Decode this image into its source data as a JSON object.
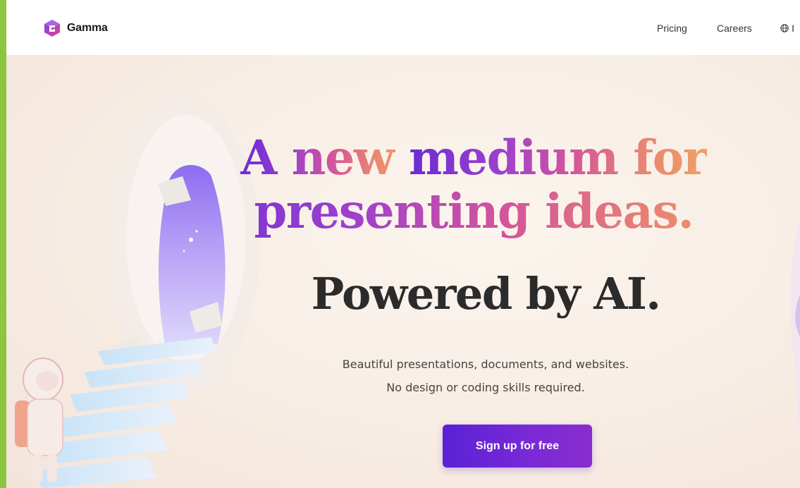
{
  "brand": {
    "name": "Gamma",
    "logo_icon": "gamma-logo-icon"
  },
  "nav": {
    "links": [
      "Pricing",
      "Careers"
    ],
    "language_icon": "globe-icon",
    "language_text": "I"
  },
  "hero": {
    "headline_line1_part1": "A new ",
    "headline_line1_part2": "medium for",
    "headline_line2": "presenting ideas.",
    "subheadline": "Powered by AI.",
    "description_line1": "Beautiful presentations, documents, and websites.",
    "description_line2": "No design or coding skills required.",
    "cta_label": "Sign up for free"
  },
  "colors": {
    "accent_purple": "#5a21d6",
    "gradient_start": "#6a2bd4",
    "gradient_end": "#eea164",
    "frame_green": "#8cc63f"
  }
}
